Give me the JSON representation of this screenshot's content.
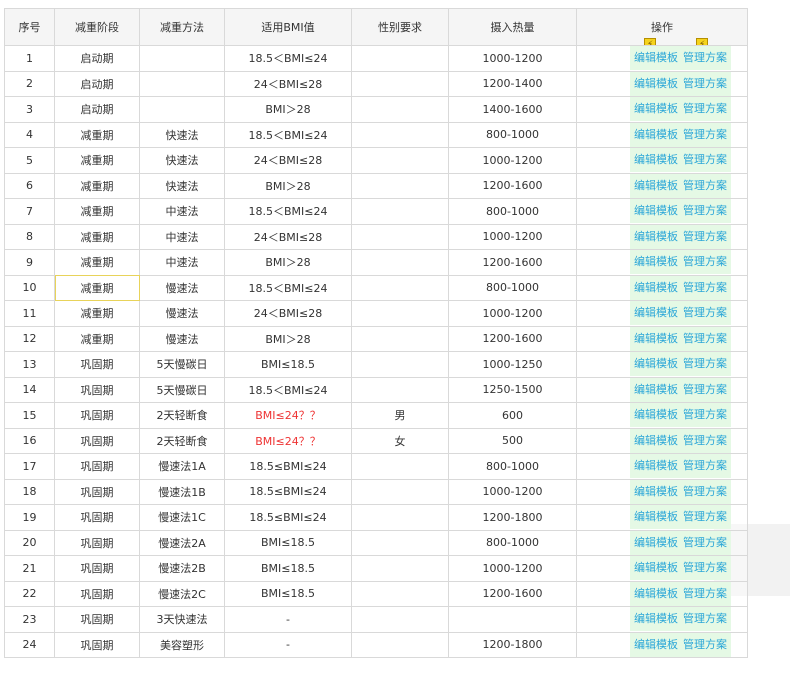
{
  "headers": [
    "序号",
    "减重阶段",
    "减重方法",
    "适用BMI值",
    "性别要求",
    "摄入热量",
    "操作"
  ],
  "op_labels": {
    "edit": "编辑模板",
    "manage": "管理方案"
  },
  "icons": {
    "bolt": "⚡"
  },
  "rows": [
    {
      "no": "1",
      "stage": "启动期",
      "method": "",
      "bmi": "18.5＜BMI≤24",
      "gender": "",
      "kcal": "1000-1200"
    },
    {
      "no": "2",
      "stage": "启动期",
      "method": "",
      "bmi": "24＜BMI≤28",
      "gender": "",
      "kcal": "1200-1400"
    },
    {
      "no": "3",
      "stage": "启动期",
      "method": "",
      "bmi": "BMI＞28",
      "gender": "",
      "kcal": "1400-1600"
    },
    {
      "no": "4",
      "stage": "减重期",
      "method": "快速法",
      "bmi": "18.5＜BMI≤24",
      "gender": "",
      "kcal": "800-1000"
    },
    {
      "no": "5",
      "stage": "减重期",
      "method": "快速法",
      "bmi": "24＜BMI≤28",
      "gender": "",
      "kcal": "1000-1200"
    },
    {
      "no": "6",
      "stage": "减重期",
      "method": "快速法",
      "bmi": "BMI＞28",
      "gender": "",
      "kcal": "1200-1600"
    },
    {
      "no": "7",
      "stage": "减重期",
      "method": "中速法",
      "bmi": "18.5＜BMI≤24",
      "gender": "",
      "kcal": "800-1000"
    },
    {
      "no": "8",
      "stage": "减重期",
      "method": "中速法",
      "bmi": "24＜BMI≤28",
      "gender": "",
      "kcal": "1000-1200"
    },
    {
      "no": "9",
      "stage": "减重期",
      "method": "中速法",
      "bmi": "BMI＞28",
      "gender": "",
      "kcal": "1200-1600"
    },
    {
      "no": "10",
      "stage": "减重期",
      "method": "慢速法",
      "bmi": "18.5＜BMI≤24",
      "gender": "",
      "kcal": "800-1000"
    },
    {
      "no": "11",
      "stage": "减重期",
      "method": "慢速法",
      "bmi": "24＜BMI≤28",
      "gender": "",
      "kcal": "1000-1200"
    },
    {
      "no": "12",
      "stage": "减重期",
      "method": "慢速法",
      "bmi": "BMI＞28",
      "gender": "",
      "kcal": "1200-1600"
    },
    {
      "no": "13",
      "stage": "巩固期",
      "method": "5天慢碳日",
      "bmi": "BMI≤18.5",
      "gender": "",
      "kcal": "1000-1250"
    },
    {
      "no": "14",
      "stage": "巩固期",
      "method": "5天慢碳日",
      "bmi": "18.5＜BMI≤24",
      "gender": "",
      "kcal": "1250-1500"
    },
    {
      "no": "15",
      "stage": "巩固期",
      "method": "2天轻断食",
      "bmi": "BMI≤24？？",
      "gender": "男",
      "kcal": "600"
    },
    {
      "no": "16",
      "stage": "巩固期",
      "method": "2天轻断食",
      "bmi": "BMI≤24？？",
      "gender": "女",
      "kcal": "500"
    },
    {
      "no": "17",
      "stage": "巩固期",
      "method": "慢速法1A",
      "bmi": "18.5≤BMI≤24",
      "gender": "",
      "kcal": "800-1000"
    },
    {
      "no": "18",
      "stage": "巩固期",
      "method": "慢速法1B",
      "bmi": "18.5≤BMI≤24",
      "gender": "",
      "kcal": "1000-1200"
    },
    {
      "no": "19",
      "stage": "巩固期",
      "method": "慢速法1C",
      "bmi": "18.5≤BMI≤24",
      "gender": "",
      "kcal": "1200-1800"
    },
    {
      "no": "20",
      "stage": "巩固期",
      "method": "慢速法2A",
      "bmi": "BMI≤18.5",
      "gender": "",
      "kcal": "800-1000"
    },
    {
      "no": "21",
      "stage": "巩固期",
      "method": "慢速法2B",
      "bmi": "BMI≤18.5",
      "gender": "",
      "kcal": "1000-1200"
    },
    {
      "no": "22",
      "stage": "巩固期",
      "method": "慢速法2C",
      "bmi": "BMI≤18.5",
      "gender": "",
      "kcal": "1200-1600"
    },
    {
      "no": "23",
      "stage": "巩固期",
      "method": "3天快速法",
      "bmi": "-",
      "gender": "",
      "kcal": ""
    },
    {
      "no": "24",
      "stage": "巩固期",
      "method": "美容塑形",
      "bmi": "-",
      "gender": "",
      "kcal": "1200-1800"
    }
  ],
  "highlight": {
    "red_bmi_rows": [
      15,
      16
    ],
    "selected_cell": "stage-row-10",
    "op_cell_color": "#e5f9e5",
    "link_color": "#2aa6d8",
    "warn_color": "#ee3333"
  }
}
